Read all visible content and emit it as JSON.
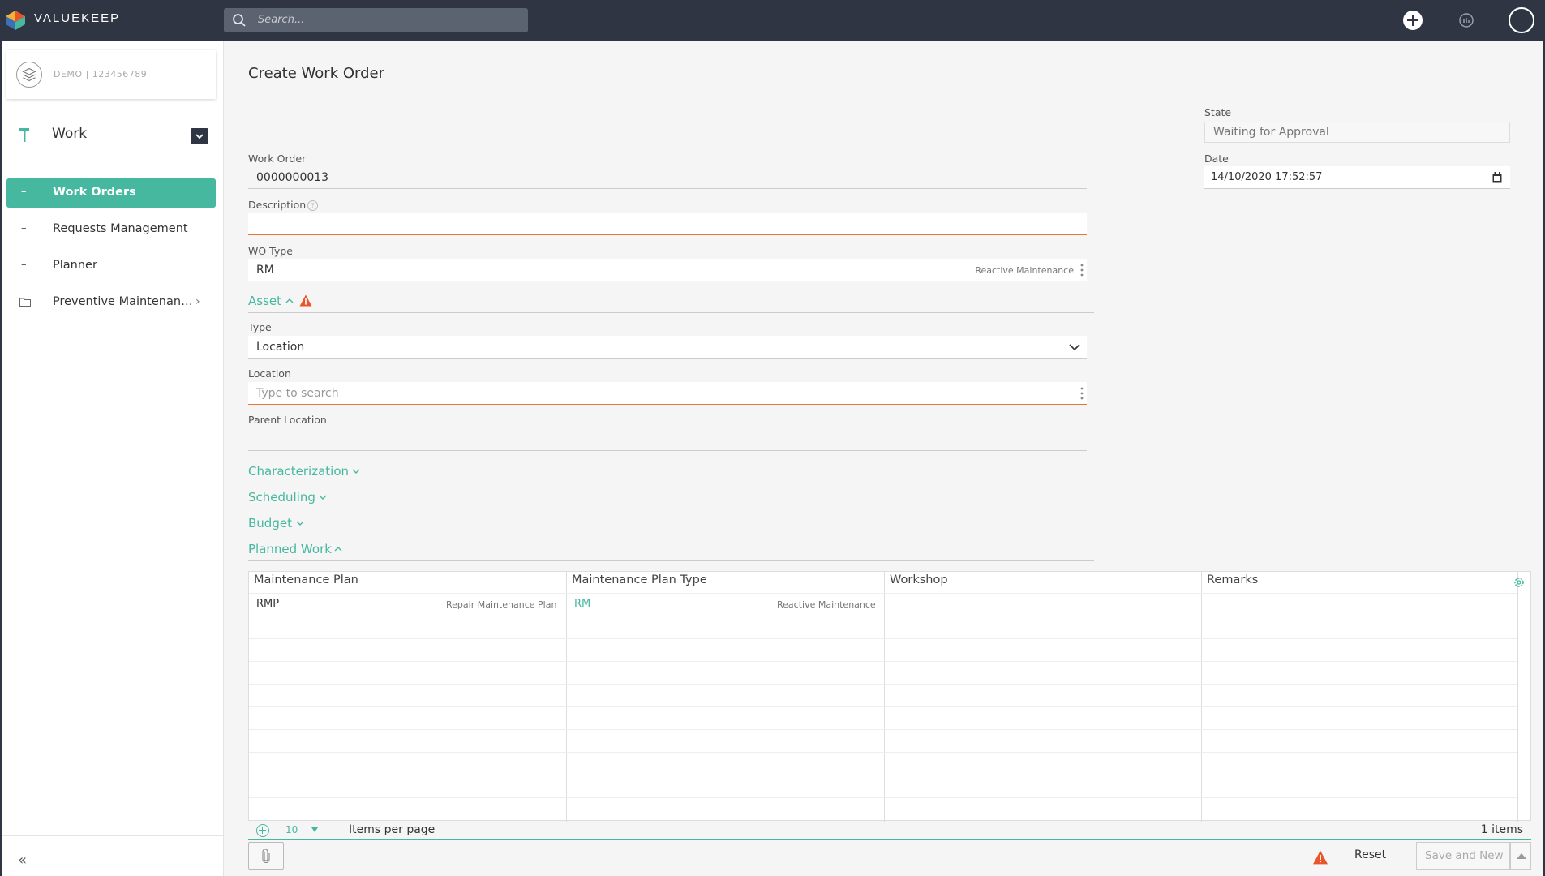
{
  "app": {
    "brand": "VALUEKEEP"
  },
  "search": {
    "placeholder": "Search..."
  },
  "sidebar": {
    "tenant": "DEMO | 123456789",
    "module": "Work",
    "items": [
      {
        "dash": "–",
        "label": "Work Orders"
      },
      {
        "dash": "–",
        "label": "Requests Management"
      },
      {
        "dash": "–",
        "label": "Planner"
      },
      {
        "label": "Preventive Maintenanc..."
      }
    ],
    "collapse": "«"
  },
  "page": {
    "title": "Create Work Order"
  },
  "form": {
    "state": {
      "label": "State",
      "value": "Waiting for Approval"
    },
    "date": {
      "label": "Date",
      "value": "14/10/2020 17:52:57"
    },
    "work_order": {
      "label": "Work Order",
      "value": "0000000013"
    },
    "description": {
      "label": "Description",
      "value": "",
      "info": "?"
    },
    "wo_type": {
      "label": "WO Type",
      "value": "RM",
      "hint": "Reactive Maintenance"
    },
    "asset": {
      "label": "Asset"
    },
    "type": {
      "label": "Type",
      "value": "Location"
    },
    "location": {
      "label": "Location",
      "placeholder": "Type to search"
    },
    "parent_location": {
      "label": "Parent Location",
      "value": ""
    }
  },
  "sections": {
    "characterization": "Characterization",
    "scheduling": "Scheduling",
    "budget": "Budget",
    "planned_work": "Planned Work"
  },
  "table": {
    "columns": [
      "Maintenance Plan",
      "Maintenance Plan Type",
      "Workshop",
      "Remarks"
    ],
    "rows": [
      {
        "plan": "RMP",
        "plan_desc": "Repair Maintenance Plan",
        "type": "RM",
        "type_desc": "Reactive Maintenance",
        "workshop": "",
        "remarks": ""
      }
    ],
    "pager": {
      "page_size": "10",
      "per_page_label": "Items per page",
      "count": "1 items"
    }
  },
  "actions": {
    "reset": "Reset",
    "save": "Save and New"
  },
  "colors": {
    "accent": "#45b89f",
    "topbar": "#2f3542",
    "warning": "#e8552a",
    "required": "#e8743b"
  }
}
